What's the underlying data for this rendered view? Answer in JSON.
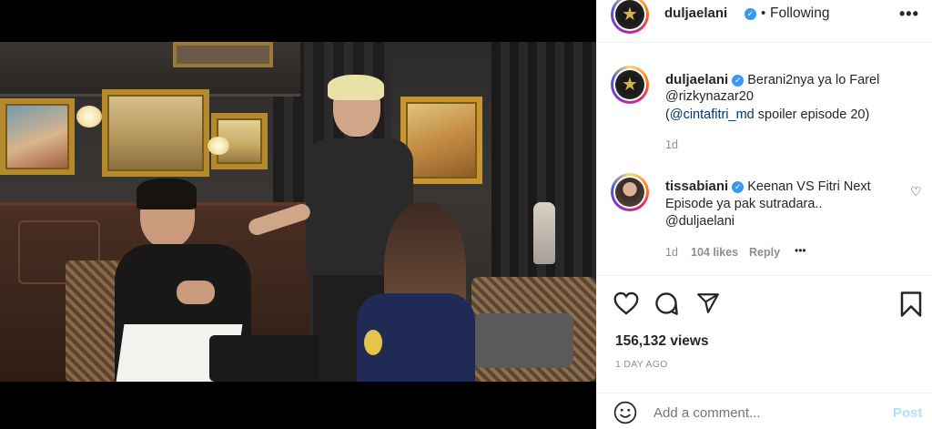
{
  "post": {
    "username": "duljaelani",
    "follow_status": "Following",
    "separator": "•",
    "more_icon": "more-horizontal-icon"
  },
  "caption": {
    "username": "duljaelani",
    "line1": "Berani2nya ya lo Farel",
    "mention1": "@rizkynazar20",
    "paren_open": "(",
    "mention2": "@cintafitri_md",
    "line3_rest": " spoiler episode 20)",
    "time": "1d"
  },
  "comment": {
    "username": "tissabiani",
    "text_part1": "Keenan VS Fitri Next",
    "text_part2": "Episode ya pak sutradara..",
    "mention": "@duljaelani",
    "time": "1d",
    "likes": "104 likes",
    "reply_label": "Reply",
    "more": "•••"
  },
  "actions": {
    "views": "156,132 views",
    "date": "1 DAY AGO"
  },
  "composer": {
    "placeholder": "Add a comment...",
    "post_label": "Post"
  },
  "colors": {
    "accent": "#3897f0",
    "link": "#00376b",
    "post_disabled": "#b2dffc"
  }
}
